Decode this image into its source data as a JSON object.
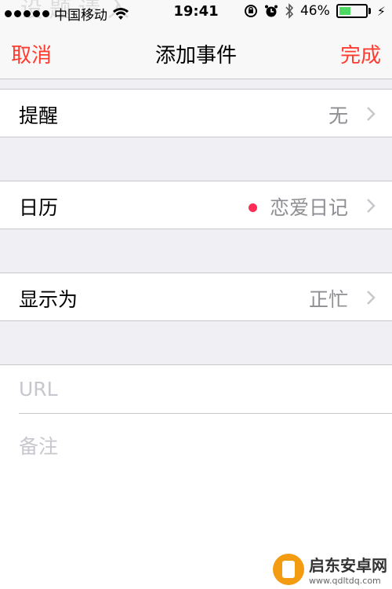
{
  "status_bar": {
    "carrier": "中国移动",
    "time": "19:41",
    "battery_percent": "46%",
    "battery_level": 0.46
  },
  "nav": {
    "cancel": "取消",
    "title": "添加事件",
    "done": "完成",
    "accent_color": "#ff3b30"
  },
  "rows": {
    "alert": {
      "label": "提醒",
      "value": "无"
    },
    "calendar": {
      "label": "日历",
      "value": "恋爱日记",
      "dot_color": "#ff2d55"
    },
    "show_as": {
      "label": "显示为",
      "value": "正忙"
    }
  },
  "notes": {
    "url_placeholder": "URL",
    "notes_placeholder": "备注"
  },
  "watermark": {
    "name": "启东安卓网",
    "url": "www.qdltdq.com"
  }
}
